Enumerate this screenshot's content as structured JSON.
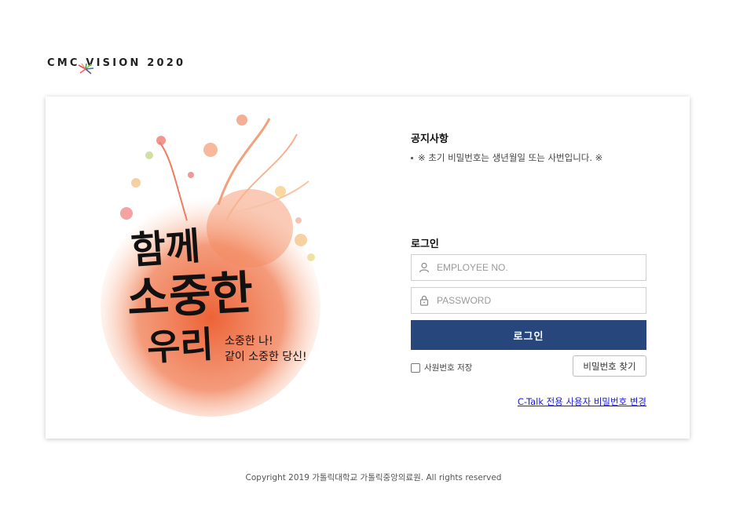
{
  "brand": {
    "title": "CMC VISION 2020"
  },
  "artwork": {
    "headline": [
      "함께",
      "소중한",
      "우리"
    ],
    "sub_lines": [
      "소중한 나!",
      "같이 소중한 당신!"
    ],
    "colors": {
      "splash": "#ef6a3c",
      "splash_light": "#f7b08a",
      "ink": "#111111"
    }
  },
  "notice": {
    "title": "공지사항",
    "items": [
      "※ 초기 비밀번호는 생년월일 또는 사번입니다. ※"
    ]
  },
  "login": {
    "title": "로그인",
    "employee_placeholder": "EMPLOYEE NO.",
    "employee_icon": "user-icon",
    "password_placeholder": "PASSWORD",
    "password_icon": "lock-icon",
    "submit_label": "로그인",
    "save_id_label": "사원번호 저장",
    "find_password_label": "비밀번호 찾기",
    "ctalk_link": "C-Talk 전용 사용자 비밀번호 변경",
    "colors": {
      "primary": "#26467c"
    }
  },
  "footer": {
    "copyright": "Copyright 2019 가톨릭대학교 가톨릭중앙의료원. All rights reserved"
  }
}
